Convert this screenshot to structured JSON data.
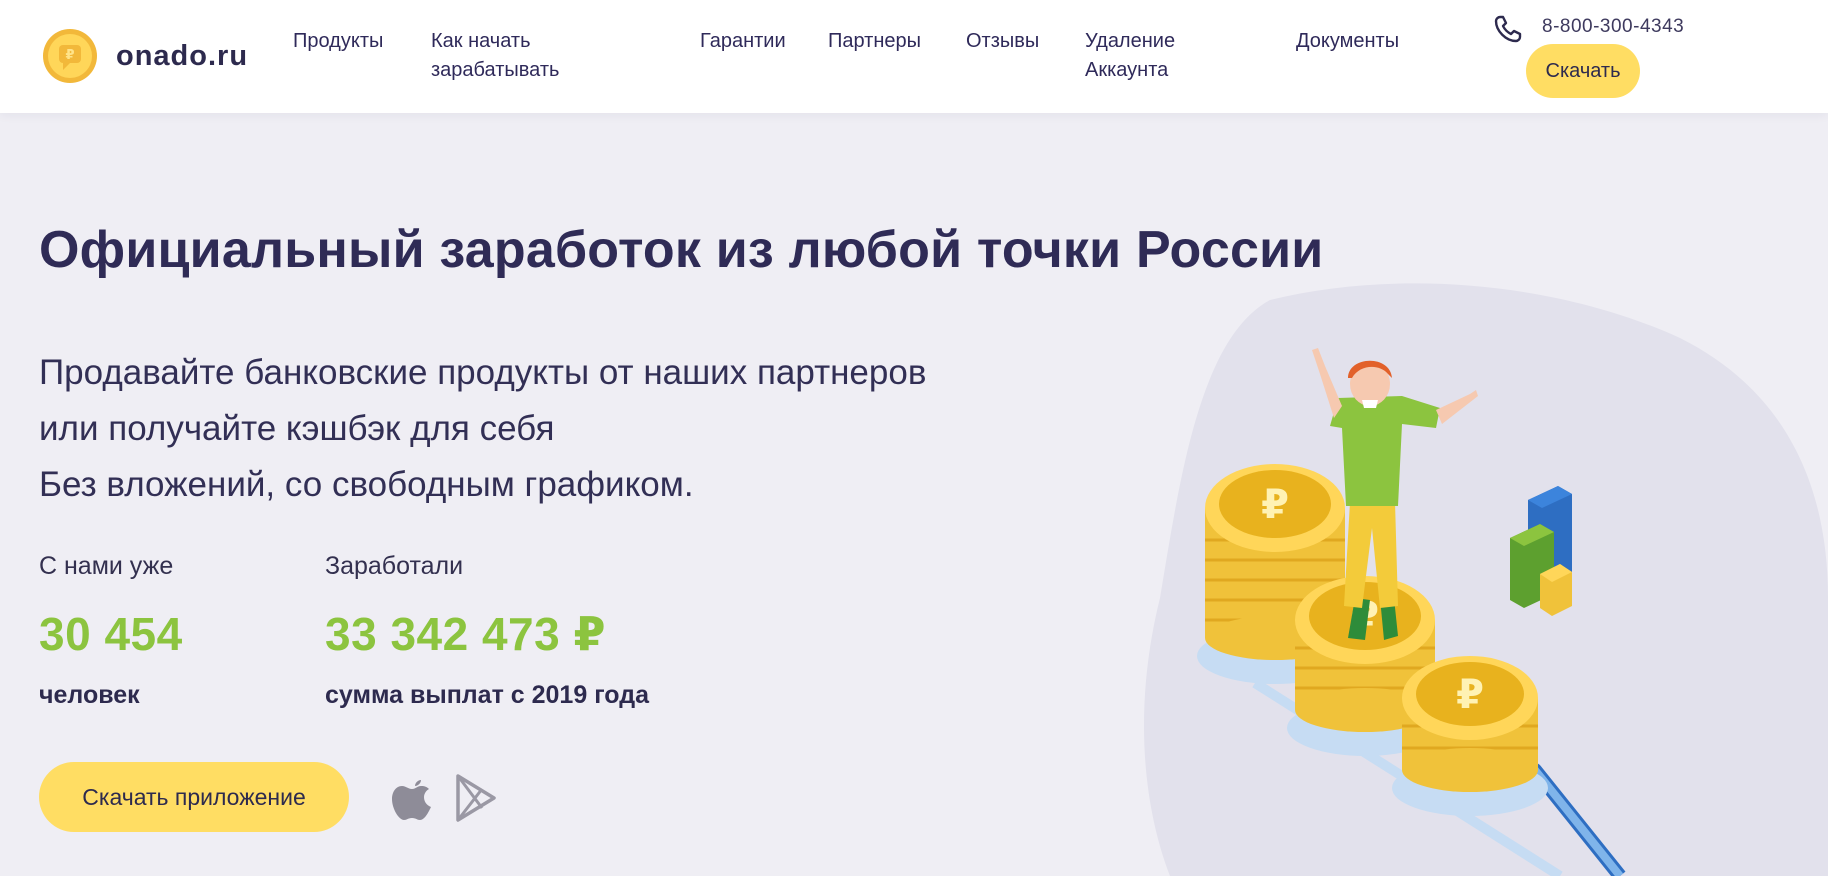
{
  "header": {
    "logo_text": "onado.ru",
    "nav": [
      {
        "label": "Продукты"
      },
      {
        "label": "Как начать\nзарабатывать"
      },
      {
        "label": "Гарантии"
      },
      {
        "label": "Партнеры"
      },
      {
        "label": "Отзывы"
      },
      {
        "label": "Удаление\nАккаунта"
      },
      {
        "label": "Документы"
      }
    ],
    "phone": "8-800-300-4343",
    "download_label": "Скачать"
  },
  "hero": {
    "title": "Официальный заработок из любой точки России",
    "subtitle_lines": [
      "Продавайте банковские продукты от наших партнеров",
      "или получайте кэшбэк для себя",
      "Без вложений, со свободным графиком."
    ],
    "stats": [
      {
        "label": "С нами уже",
        "value": "30 454",
        "caption": "человек"
      },
      {
        "label": "Заработали",
        "value": "33 342 473 ₽",
        "caption": "сумма выплат с 2019 года"
      }
    ],
    "cta_label": "Скачать приложение",
    "store_icons": [
      "apple-icon",
      "google-play-icon"
    ]
  },
  "colors": {
    "accent_yellow": "#ffdd63",
    "stat_green": "#8cc43f",
    "text_dark": "#2d2a4e",
    "page_bg": "#efeef4"
  }
}
